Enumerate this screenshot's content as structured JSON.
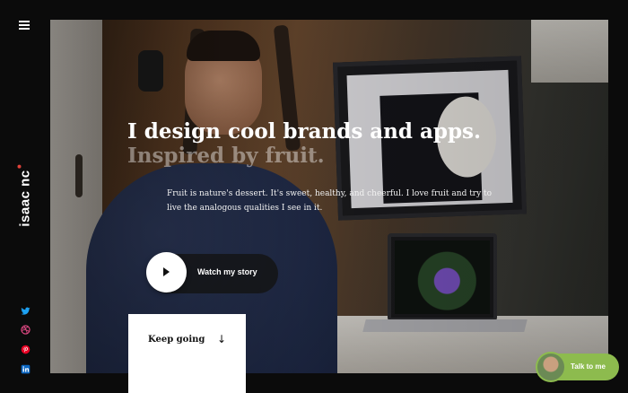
{
  "logo": {
    "text": "isaac nc"
  },
  "hero": {
    "headline": "I design cool brands and apps.",
    "subheadline": "Inspired by fruit.",
    "intro": "Fruit is nature's dessert. It's sweet, healthy, and cheerful. I love fruit and try to live the analogous qualities I see in it."
  },
  "story_button": {
    "label": "Watch my story",
    "icon": "play-icon"
  },
  "keep_going": {
    "label": "Keep going",
    "icon": "arrow-down-icon",
    "arrow": "↓"
  },
  "talk": {
    "label": "Talk to me",
    "icon": "avatar"
  },
  "social": [
    {
      "name": "twitter-icon",
      "color": "#1da1f2"
    },
    {
      "name": "dribbble-icon",
      "color": "#ea4c89"
    },
    {
      "name": "pinterest-icon",
      "color": "#e60023"
    },
    {
      "name": "linkedin-icon",
      "color": "#0a66c2"
    }
  ],
  "colors": {
    "accent": "#8dbb4e",
    "background": "#0b0b0b",
    "logo_dot": "#e0423a"
  }
}
